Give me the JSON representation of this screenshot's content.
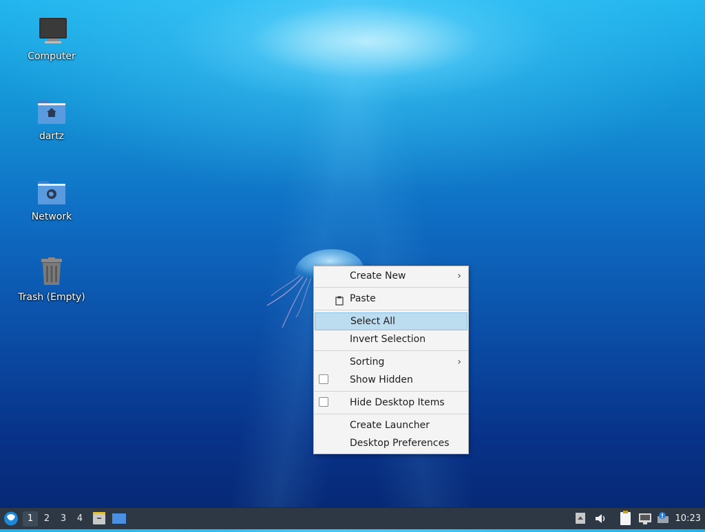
{
  "desktop": {
    "icons": [
      {
        "label": "Computer"
      },
      {
        "label": "dartz"
      },
      {
        "label": "Network"
      },
      {
        "label": "Trash (Empty)"
      }
    ]
  },
  "context_menu": {
    "create_new": "Create New",
    "paste": "Paste",
    "select_all": "Select All",
    "invert_selection": "Invert Selection",
    "sorting": "Sorting",
    "show_hidden": "Show Hidden",
    "hide_desktop_items": "Hide Desktop Items",
    "create_launcher": "Create Launcher",
    "desktop_preferences": "Desktop Preferences",
    "highlighted": "Select All",
    "submenu_arrow": "›"
  },
  "taskbar": {
    "workspaces": [
      "1",
      "2",
      "3",
      "4"
    ],
    "active_workspace": "1",
    "clock": "10:23",
    "icons": [
      "start-menu-icon",
      "file-manager-icon",
      "show-desktop-icon",
      "tray-up-icon",
      "volume-icon",
      "clipboard-icon",
      "network-icon",
      "update-notifier-icon"
    ]
  },
  "colors": {
    "menu_bg": "#f4f4f4",
    "menu_highlight": "#bcdcf0",
    "taskbar_bg": "#2d3844",
    "folder_blue": "#4a8fd8"
  }
}
